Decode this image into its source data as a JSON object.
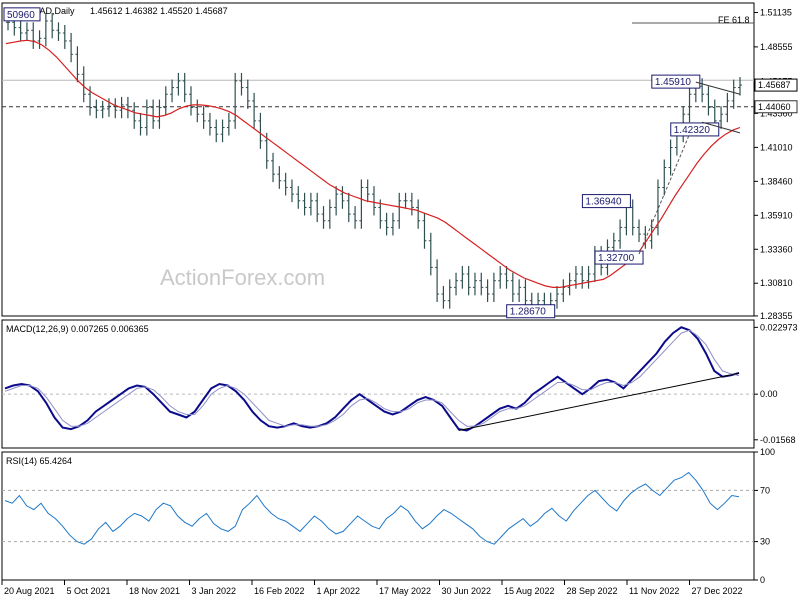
{
  "watermark": "ActionForex.com",
  "price_header": {
    "symbol": "EURCAD,Daily",
    "ohlc": "1.45612 1.46382 1.45520 1.45687"
  },
  "macd_header": "MACD(12,26,9) 0.007265 0.006365",
  "rsi_header": "RSI(14) 65.4264",
  "fe_label": "FE 61.8",
  "colors": {
    "bars": "#2f4f4f",
    "ma": "#d62020",
    "macd": "#0b0b8c",
    "signal": "#9090c8",
    "rsi": "#1e78c8",
    "label_border": "#1a1a6e"
  },
  "chart_data": [
    {
      "type": "ohlc",
      "title": "EURCAD,Daily",
      "y_ticks": [
        "1.51135",
        "1.48555",
        "1.45975",
        "1.43560",
        "1.41010",
        "1.38460",
        "1.35910",
        "1.33360",
        "1.30810",
        "1.28355"
      ],
      "ylim": [
        1.2835,
        1.5185
      ],
      "price_labels": [
        {
          "text": "1.45687",
          "value": 1.45687,
          "style": "current"
        },
        {
          "text": "1.44060",
          "value": 1.4406,
          "style": "level"
        }
      ],
      "reference_lines": [
        {
          "value": 1.4406,
          "style": "dashed"
        },
        {
          "value": 1.4605,
          "style": "solid-gray"
        },
        {
          "value": 1.5035,
          "style": "fe"
        }
      ],
      "pivot_labels": [
        {
          "text": "50960",
          "value": 1.5096,
          "x_index": 0
        },
        {
          "text": "1.45910",
          "value": 1.4591,
          "x_index": 109
        },
        {
          "text": "1.42320",
          "value": 1.4232,
          "x_index": 112
        },
        {
          "text": "1.36940",
          "value": 1.3694,
          "x_index": 98
        },
        {
          "text": "1.32700",
          "value": 1.327,
          "x_index": 100
        },
        {
          "text": "1.28670",
          "value": 1.2867,
          "x_index": 86
        }
      ],
      "series": [
        {
          "name": "",
          "type": "ohlc",
          "close": [
            1.504,
            1.5,
            1.496,
            1.498,
            1.49,
            1.492,
            1.505,
            1.498,
            1.496,
            1.49,
            1.48,
            1.465,
            1.45,
            1.44,
            1.438,
            1.439,
            1.441,
            1.438,
            1.442,
            1.438,
            1.43,
            1.425,
            1.44,
            1.43,
            1.44,
            1.45,
            1.455,
            1.46,
            1.45,
            1.44,
            1.435,
            1.43,
            1.425,
            1.42,
            1.425,
            1.43,
            1.46,
            1.455,
            1.445,
            1.43,
            1.415,
            1.4,
            1.39,
            1.385,
            1.38,
            1.375,
            1.37,
            1.365,
            1.37,
            1.36,
            1.355,
            1.365,
            1.375,
            1.37,
            1.36,
            1.355,
            1.38,
            1.375,
            1.365,
            1.355,
            1.35,
            1.355,
            1.37,
            1.37,
            1.365,
            1.355,
            1.34,
            1.32,
            1.3,
            1.295,
            1.305,
            1.31,
            1.315,
            1.305,
            1.31,
            1.305,
            1.3,
            1.31,
            1.315,
            1.31,
            1.3,
            1.305,
            1.295,
            1.29,
            1.295,
            1.29,
            1.295,
            1.3,
            1.305,
            1.31,
            1.315,
            1.31,
            1.315,
            1.33,
            1.32,
            1.335,
            1.34,
            1.35,
            1.365,
            1.35,
            1.345,
            1.34,
            1.35,
            1.38,
            1.395,
            1.41,
            1.42,
            1.435,
            1.45,
            1.456,
            1.45,
            1.44,
            1.43,
            1.435,
            1.445,
            1.455,
            1.4569
          ]
        },
        {
          "name": "",
          "type": "line",
          "values": [
            1.488,
            1.489,
            1.49,
            1.4905,
            1.4895,
            1.487,
            1.483,
            1.478,
            1.472,
            1.466,
            1.46,
            1.455,
            1.451,
            1.448,
            1.445,
            1.442,
            1.44,
            1.438,
            1.436,
            1.435,
            1.434,
            1.433,
            1.434,
            1.436,
            1.439,
            1.441,
            1.442,
            1.442,
            1.4415,
            1.4405,
            1.439,
            1.437,
            1.434,
            1.43,
            1.426,
            1.422,
            1.418,
            1.414,
            1.41,
            1.406,
            1.402,
            1.398,
            1.394,
            1.39,
            1.386,
            1.382,
            1.379,
            1.376,
            1.374,
            1.372,
            1.37,
            1.369,
            1.368,
            1.367,
            1.366,
            1.365,
            1.364,
            1.363,
            1.361,
            1.359,
            1.357,
            1.354,
            1.35,
            1.346,
            1.342,
            1.338,
            1.334,
            1.33,
            1.326,
            1.322,
            1.318,
            1.315,
            1.312,
            1.31,
            1.308,
            1.306,
            1.305,
            1.305,
            1.306,
            1.307,
            1.308,
            1.309,
            1.31,
            1.311,
            1.314,
            1.318,
            1.322,
            1.326,
            1.332,
            1.34,
            1.348,
            1.356,
            1.365,
            1.374,
            1.382,
            1.39,
            1.398,
            1.405,
            1.411,
            1.416,
            1.42,
            1.423,
            1.425
          ]
        }
      ]
    },
    {
      "type": "line",
      "title": "MACD(12,26,9)",
      "y_ticks": [
        "0.022973",
        "0.00",
        "-0.01568"
      ],
      "ylim": [
        -0.0185,
        0.0255
      ],
      "series": [
        {
          "name": "MACD",
          "values": [
            0.002,
            0.003,
            0.0035,
            0.003,
            0.001,
            -0.003,
            -0.008,
            -0.0115,
            -0.012,
            -0.011,
            -0.009,
            -0.006,
            -0.004,
            -0.002,
            0.0,
            0.002,
            0.003,
            0.0025,
            0.0,
            -0.003,
            -0.006,
            -0.007,
            -0.008,
            -0.006,
            -0.002,
            0.002,
            0.0035,
            0.003,
            0.001,
            -0.002,
            -0.006,
            -0.009,
            -0.011,
            -0.0115,
            -0.011,
            -0.01,
            -0.011,
            -0.0115,
            -0.011,
            -0.01,
            -0.008,
            -0.005,
            -0.002,
            0.0,
            -0.002,
            -0.004,
            -0.006,
            -0.007,
            -0.006,
            -0.004,
            -0.002,
            -0.001,
            -0.002,
            -0.004,
            -0.008,
            -0.012,
            -0.0125,
            -0.011,
            -0.009,
            -0.007,
            -0.005,
            -0.004,
            -0.005,
            -0.003,
            0.0,
            0.002,
            0.004,
            0.006,
            0.004,
            0.002,
            0.0,
            0.002,
            0.0045,
            0.005,
            0.004,
            0.002,
            0.005,
            0.008,
            0.011,
            0.014,
            0.018,
            0.021,
            0.023,
            0.022,
            0.019,
            0.014,
            0.008,
            0.006,
            0.0065,
            0.0073
          ]
        },
        {
          "name": "Signal",
          "values": [
            0.001,
            0.002,
            0.003,
            0.003,
            0.002,
            -0.001,
            -0.005,
            -0.009,
            -0.011,
            -0.011,
            -0.01,
            -0.008,
            -0.006,
            -0.004,
            -0.002,
            0.0,
            0.002,
            0.0025,
            0.0015,
            -0.001,
            -0.004,
            -0.006,
            -0.007,
            -0.007,
            -0.004,
            0.0,
            0.002,
            0.003,
            0.002,
            0.0,
            -0.003,
            -0.006,
            -0.009,
            -0.01,
            -0.011,
            -0.0105,
            -0.0105,
            -0.011,
            -0.011,
            -0.0105,
            -0.009,
            -0.007,
            -0.004,
            -0.002,
            -0.0015,
            -0.003,
            -0.005,
            -0.006,
            -0.006,
            -0.005,
            -0.003,
            -0.002,
            -0.002,
            -0.003,
            -0.006,
            -0.009,
            -0.011,
            -0.011,
            -0.01,
            -0.008,
            -0.006,
            -0.005,
            -0.005,
            -0.004,
            -0.002,
            0.0,
            0.002,
            0.004,
            0.004,
            0.003,
            0.0015,
            0.0015,
            0.003,
            0.004,
            0.004,
            0.003,
            0.004,
            0.006,
            0.009,
            0.012,
            0.015,
            0.018,
            0.021,
            0.022,
            0.02,
            0.017,
            0.012,
            0.008,
            0.007,
            0.0064
          ]
        }
      ]
    },
    {
      "type": "line",
      "title": "RSI(14)",
      "y_ticks": [
        "100",
        "70",
        "30",
        "0"
      ],
      "ylim": [
        0,
        100
      ],
      "reference_lines": [
        70,
        30
      ],
      "series": [
        {
          "name": "RSI",
          "values": [
            62,
            60,
            66,
            58,
            55,
            60,
            52,
            48,
            42,
            35,
            30,
            28,
            32,
            40,
            45,
            38,
            42,
            48,
            52,
            50,
            46,
            55,
            60,
            58,
            50,
            45,
            42,
            48,
            52,
            44,
            40,
            38,
            42,
            55,
            60,
            66,
            58,
            52,
            48,
            46,
            42,
            38,
            44,
            50,
            46,
            40,
            36,
            38,
            44,
            50,
            46,
            42,
            40,
            48,
            52,
            58,
            54,
            46,
            40,
            44,
            50,
            55,
            52,
            48,
            44,
            40,
            34,
            30,
            28,
            34,
            40,
            44,
            48,
            42,
            46,
            52,
            56,
            50,
            46,
            54,
            60,
            66,
            70,
            64,
            58,
            54,
            62,
            68,
            72,
            75,
            70,
            66,
            72,
            78,
            80,
            84,
            78,
            70,
            60,
            55,
            60,
            66,
            65
          ]
        }
      ]
    }
  ],
  "x_axis": {
    "tick_labels": [
      "20 Aug 2021",
      "5 Oct 2021",
      "18 Nov 2021",
      "3 Jan 2022",
      "16 Feb 2022",
      "1 Apr 2022",
      "17 May 2022",
      "30 Jun 2022",
      "15 Aug 2022",
      "28 Sep 2022",
      "11 Nov 2022",
      "27 Dec 2022"
    ]
  }
}
